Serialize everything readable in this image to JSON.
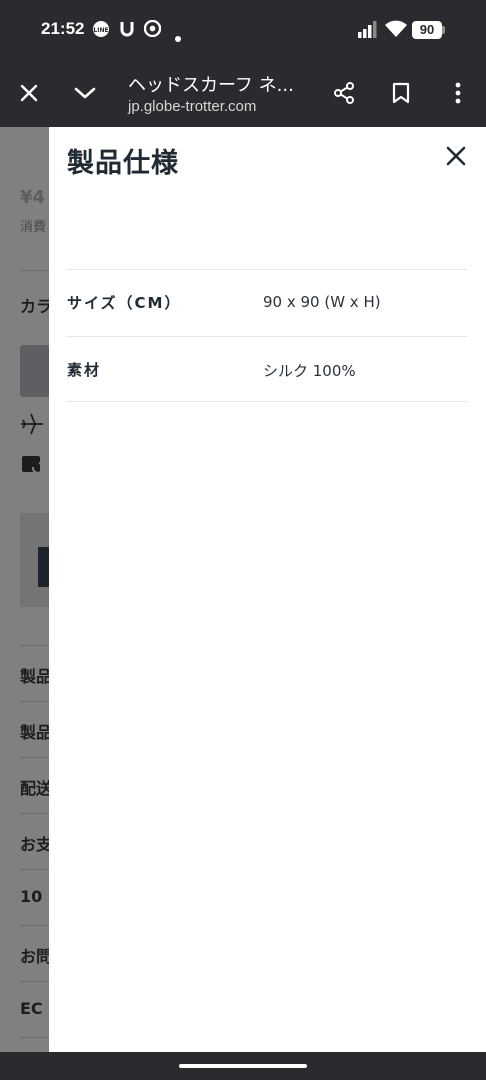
{
  "status_bar": {
    "time": "21:52",
    "battery": "90",
    "left_icons": [
      "line-icon",
      "magnet-icon",
      "chrome-icon",
      "dot-icon"
    ],
    "right_icons": [
      "signal-icon",
      "wifi-icon",
      "battery-icon"
    ]
  },
  "toolbar": {
    "title": "ヘッドスカーフ ネ...",
    "url": "jp.globe-trotter.com",
    "icons": [
      "close-icon",
      "chevron-down-icon",
      "share-icon",
      "bookmark-icon",
      "more-vert-icon"
    ]
  },
  "background_page": {
    "price_fragment": "¥4",
    "tax_fragment": "消費",
    "color_fragment": "カラ",
    "items": [
      "製品",
      "製品",
      "配送",
      "お支",
      "10",
      "お問",
      "EC"
    ]
  },
  "panel": {
    "title": "製品仕様",
    "specs": [
      {
        "label": "サイズ（CM）",
        "value": "90 x 90 (W x H)"
      },
      {
        "label": "素材",
        "value": "シルク 100%"
      }
    ]
  },
  "colors": {
    "system_bar": "#2a2b2e",
    "panel_bg": "#ffffff",
    "text_dark": "#1f2a33",
    "overlay": "#808080"
  }
}
